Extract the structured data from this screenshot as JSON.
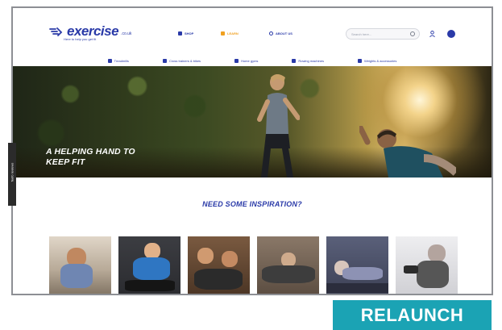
{
  "header": {
    "logo_text": "exercise",
    "logo_suffix": ".co.uk",
    "tagline": "Here to help you get fit",
    "nav": [
      {
        "label": "SHOP",
        "icon": "cart-icon",
        "color": "#2a3aa8"
      },
      {
        "label": "LEARN",
        "icon": "lightbulb-icon",
        "color": "#f0a020"
      },
      {
        "label": "ABOUT US",
        "icon": "info-icon",
        "color": "#2a3aa8"
      }
    ],
    "search_placeholder": "Search here..."
  },
  "categories": [
    {
      "label": "Treadmills",
      "icon": "treadmill-icon"
    },
    {
      "label": "Cross trainers & bikes",
      "icon": "bike-icon"
    },
    {
      "label": "Home gyms",
      "icon": "dumbbell-icon"
    },
    {
      "label": "Rowing machines",
      "icon": "rowing-icon"
    },
    {
      "label": "Weights & accessories",
      "icon": "weights-icon"
    }
  ],
  "hero": {
    "title_line1": "A HELPING HAND TO",
    "title_line2": "KEEP FIT"
  },
  "side_tab": "feefo reviews",
  "inspiration": {
    "title": "NEED SOME INSPIRATION?",
    "thumbnails": [
      {
        "label": "running",
        "colors": [
          "#d0c4b4",
          "#7a8fb0",
          "#b08060"
        ]
      },
      {
        "label": "stretching",
        "colors": [
          "#3a3a3a",
          "#2b6fb8",
          "#e2b08a"
        ]
      },
      {
        "label": "partner workout",
        "colors": [
          "#6a4a34",
          "#c89068",
          "#2a2a2a"
        ]
      },
      {
        "label": "yoga",
        "colors": [
          "#7a6a5a",
          "#c9a88a",
          "#3a3a3a"
        ]
      },
      {
        "label": "floor exercise",
        "colors": [
          "#4a4f66",
          "#8a8fb0",
          "#d2c8c0"
        ]
      },
      {
        "label": "weights",
        "colors": [
          "#e6e6ea",
          "#5a5a5a",
          "#b0a4a0"
        ]
      }
    ]
  },
  "banner": "RELAUNCH",
  "colors": {
    "brand_blue": "#2a3aa8",
    "teal": "#1ba3b4",
    "accent_orange": "#f0a020"
  }
}
